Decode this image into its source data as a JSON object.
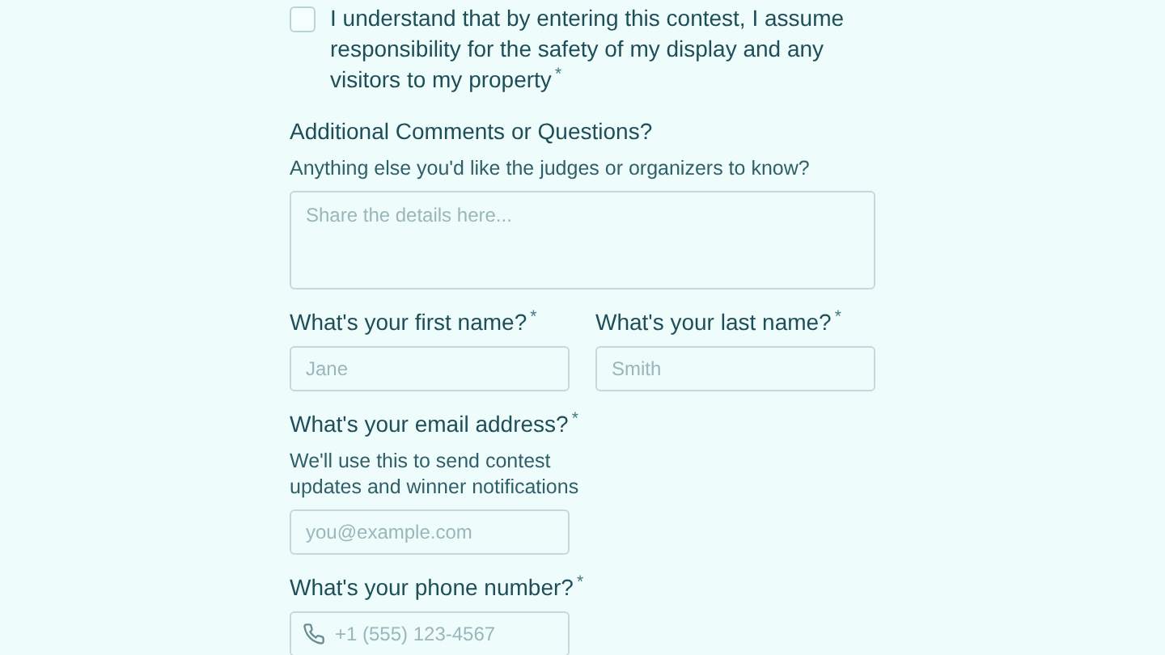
{
  "consent": {
    "checked": false,
    "text": "I understand that by entering this contest, I assume responsibility for the safety of my display and any visitors to my property$^{*}$"
  },
  "comments": {
    "label": "Additional Comments or Questions?",
    "help": "Anything else you'd like the judges or organizers to know?",
    "placeholder": "Share the details here..."
  },
  "name_fields": [
    {
      "label": "What's your first name?$^{*}$",
      "placeholder": "Jane"
    },
    {
      "label": "What's your last name?$^{*}$",
      "placeholder": "Smith"
    }
  ],
  "email": {
    "label": "What's your email address?$^{*}$",
    "help": "We'll use this to send contest updates and winner notifications",
    "placeholder": "you@example.com"
  },
  "phone": {
    "label": "What's your phone number?$^{*}$",
    "placeholder": "+1 (555) 123-4567"
  }
}
